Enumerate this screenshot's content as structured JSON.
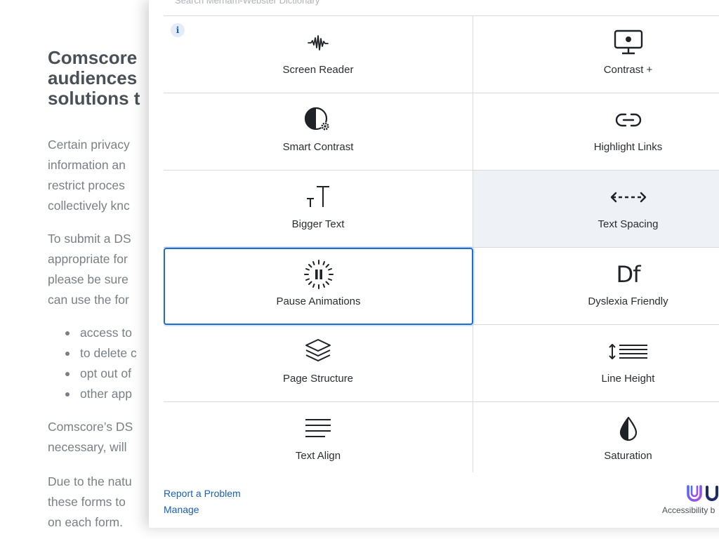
{
  "background_page": {
    "heading_lines": [
      "Comscore",
      "audiences",
      "solutions t"
    ],
    "paragraph1_lines": [
      "Certain privacy",
      "information an",
      "restrict proces",
      "collectively knc"
    ],
    "paragraph2_lines": [
      "To submit a DS",
      "appropriate for",
      "please be sure",
      "can use the for"
    ],
    "list_items": [
      "access to",
      "to delete c",
      "opt out of",
      "other app"
    ],
    "paragraph3_lines": [
      "Comscore’s DS",
      "necessary, will"
    ],
    "paragraph4_lines": [
      "Due to the natu",
      "these forms to",
      "on each form."
    ]
  },
  "accessibility_panel": {
    "search": {
      "placeholder": "Search Merriam-Webster Dictionary",
      "value": ""
    },
    "info_badge": "i",
    "tiles": [
      {
        "label": "Screen Reader",
        "icon": "waveform-icon",
        "state": "default"
      },
      {
        "label": "Contrast +",
        "icon": "monitor-icon",
        "state": "default"
      },
      {
        "label": "Smart Contrast",
        "icon": "contrast-gear-icon",
        "state": "default"
      },
      {
        "label": "Highlight Links",
        "icon": "link-icon",
        "state": "default"
      },
      {
        "label": "Bigger Text",
        "icon": "text-size-icon",
        "state": "default"
      },
      {
        "label": "Text Spacing",
        "icon": "text-spacing-icon",
        "state": "active"
      },
      {
        "label": "Pause Animations",
        "icon": "pause-icon",
        "state": "focused"
      },
      {
        "label": "Dyslexia Friendly",
        "icon": "dyslexia-icon",
        "icon_text": "Df",
        "state": "default"
      },
      {
        "label": "Page Structure",
        "icon": "layers-icon",
        "state": "default"
      },
      {
        "label": "Line Height",
        "icon": "line-height-icon",
        "state": "default"
      },
      {
        "label": "Text Align",
        "icon": "text-align-icon",
        "state": "default"
      },
      {
        "label": "Saturation",
        "icon": "droplet-icon",
        "state": "default"
      }
    ],
    "footer": {
      "report_link": "Report a Problem",
      "manage_link": "Manage",
      "brand_caption": "Accessibility b"
    }
  },
  "colors": {
    "link": "#1a5fb4",
    "focus_outline": "#1a6fd1",
    "active_tile_bg": "#eef2f6",
    "brand_gradient_start": "#4c6cf5",
    "brand_gradient_end": "#b147e8",
    "background_text": "#7a7f86",
    "background_heading": "#4a5058"
  }
}
